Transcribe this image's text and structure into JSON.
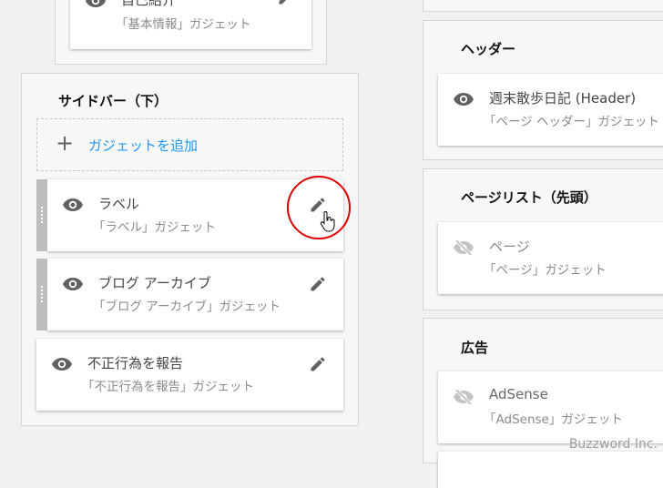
{
  "top_card": {
    "title": "自己紹介",
    "subtitle": "「基本情報」ガジェット"
  },
  "sidebar_bottom": {
    "title": "サイドバー（下）",
    "add_label": "ガジェットを追加",
    "gadgets": [
      {
        "title": "ラベル",
        "subtitle": "「ラベル」ガジェット",
        "visible": true
      },
      {
        "title": "ブログ アーカイブ",
        "subtitle": "「ブログ アーカイブ」ガジェット",
        "visible": true
      },
      {
        "title": "不正行為を報告",
        "subtitle": "「不正行為を報告」ガジェット",
        "visible": true
      }
    ]
  },
  "header_section": {
    "title": "ヘッダー",
    "gadget": {
      "title": "週末散歩日記 (Header)",
      "subtitle": "「ページ ヘッダー」ガジェット",
      "visible": true
    }
  },
  "pagelist_section": {
    "title": "ページリスト（先頭）",
    "gadget": {
      "title": "ページ",
      "subtitle": "「ページ」ガジェット",
      "visible": false
    }
  },
  "ads_section": {
    "title": "広告",
    "gadget": {
      "title": "AdSense",
      "subtitle": "「AdSense」ガジェット",
      "visible": false
    }
  },
  "colors": {
    "accent": "#2196f3",
    "highlight_circle": "#e00000"
  },
  "watermark": "Buzzword Inc."
}
